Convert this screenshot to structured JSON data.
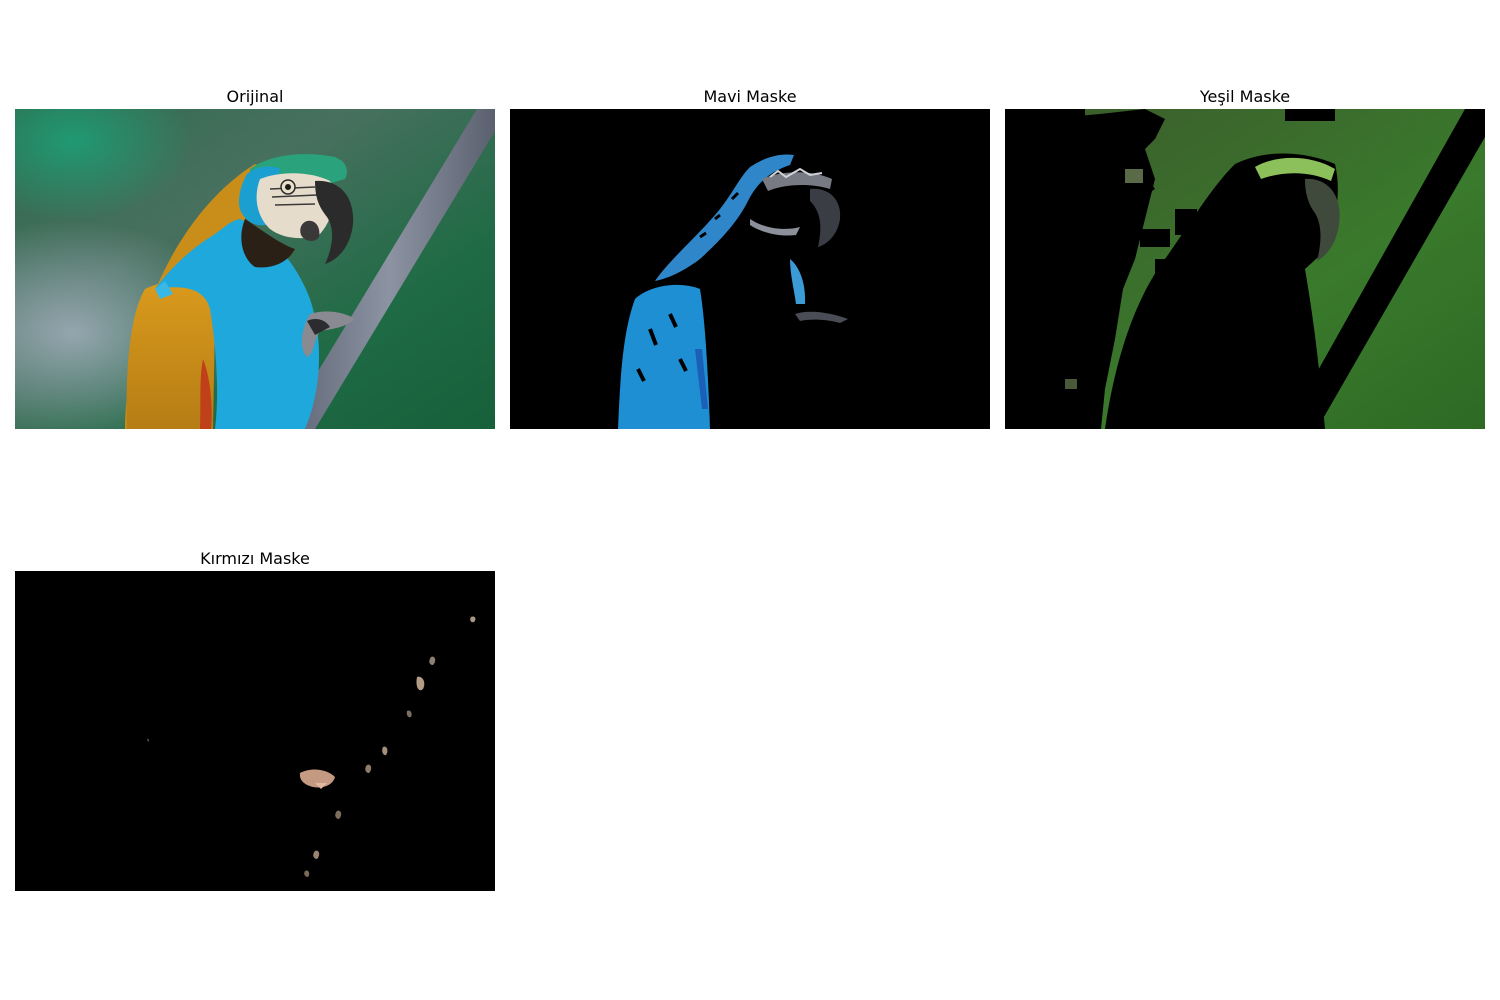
{
  "panels": [
    {
      "title": "Orijinal"
    },
    {
      "title": "Mavi Maske"
    },
    {
      "title": "Yeşil Maske"
    },
    {
      "title": "Kırmızı Maske"
    }
  ]
}
